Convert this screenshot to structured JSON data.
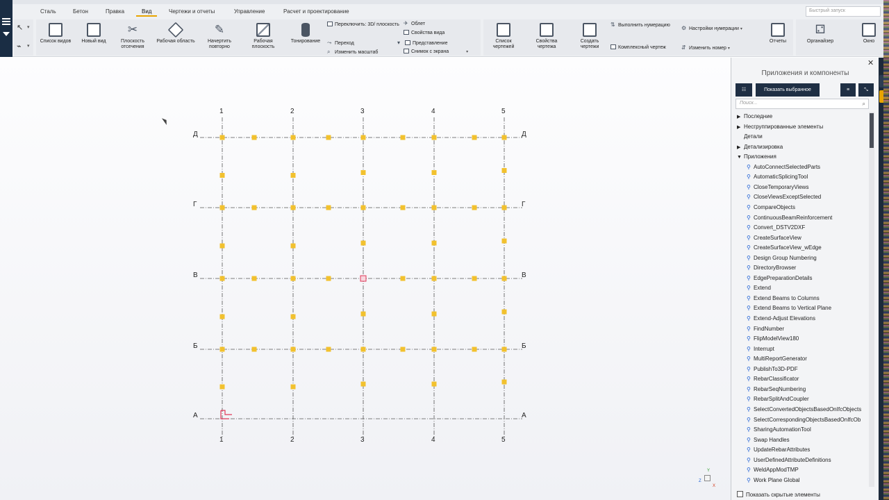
{
  "ribbon": {
    "tabs": [
      "Сталь",
      "Бетон",
      "Правка",
      "Вид",
      "Чертежи и отчеты",
      "Управление",
      "Расчет и проектирование"
    ],
    "active_tab": "Вид",
    "quick_search_placeholder": "Быстрый запуск",
    "view_buttons": {
      "view_list": "Список видов",
      "new_view": "Новый вид",
      "clip_plane": "Плоскость отсечения",
      "work_area": "Рабочая область",
      "redraw": "Начертить повторно",
      "work_plane": "Рабочая плоскость",
      "rendering": "Тонирование"
    },
    "view_small": {
      "switch_3d": "Переключить: 3D/ плоскость",
      "transition": "Переход",
      "change_scale": "Изменить масштаб",
      "flyby": "Облет",
      "view_props": "Свойства вида",
      "representation": "Представление",
      "screenshot": "Снимок с экрана"
    },
    "drawing_buttons": {
      "drawing_list": "Список чертежей",
      "drawing_props": "Свойства чертежа",
      "create_drawings": "Создать чертежи",
      "reports": "Отчеты",
      "organizer": "Органайзер",
      "window": "Окно"
    },
    "drawing_small": {
      "run_numbering": "Выполнить нумерацию",
      "complex_drawing": "Комплексный чертеж",
      "numbering_settings": "Настройки нумерации",
      "change_number": "Изменить номер"
    }
  },
  "grid": {
    "columns": [
      "1",
      "2",
      "3",
      "4",
      "5"
    ],
    "rows": [
      "Д",
      "Г",
      "В",
      "Б",
      "А"
    ]
  },
  "panel": {
    "title": "Приложения и компоненты",
    "show_selected_label": "Показать выбранное",
    "search_placeholder": "Поиск...",
    "show_hidden_label": "Показать скрытые элементы",
    "categories": [
      {
        "label": "Последние",
        "toggle": "collapsed"
      },
      {
        "label": "Несгруппированные элементы",
        "toggle": "collapsed"
      },
      {
        "label": "Детали",
        "toggle": "none"
      },
      {
        "label": "Детализировка",
        "toggle": "collapsed"
      },
      {
        "label": "Приложения",
        "toggle": "expanded"
      }
    ],
    "applications": [
      "AutoConnectSelectedParts",
      "AutomaticSplicingTool",
      "CloseTemporaryViews",
      "CloseViewsExceptSelected",
      "CompareObjects",
      "ContinuousBeamReinforcement",
      "Convert_DSTV2DXF",
      "CreateSurfaceView",
      "CreateSurfaceView_wEdge",
      "Design Group Numbering",
      "DirectoryBrowser",
      "EdgePreparationDetails",
      "Extend",
      "Extend Beams to Columns",
      "Extend Beams to Vertical Plane",
      "Extend-Adjust Elevations",
      "FindNumber",
      "FlipModelView180",
      "Interrupt",
      "MultiReportGenerator",
      "PublishTo3D-PDF",
      "RebarClassificator",
      "RebarSeqNumbering",
      "RebarSplitAndCoupler",
      "SelectConvertedObjectsBasedOnIfcObjects",
      "SelectCorrespondingObjectsBasedOnIfcOb",
      "SharingAutomationTool",
      "Swap Handles",
      "UpdateRebarAttributes",
      "UserDefinedAttributeDefinitions",
      "WeldAppModTMP",
      "Work Plane Global"
    ]
  },
  "colors": {
    "accent": "#e8a400",
    "node": "#f2c12e",
    "selected_node": "#e03a5a",
    "dark_panel": "#1f2f44"
  }
}
